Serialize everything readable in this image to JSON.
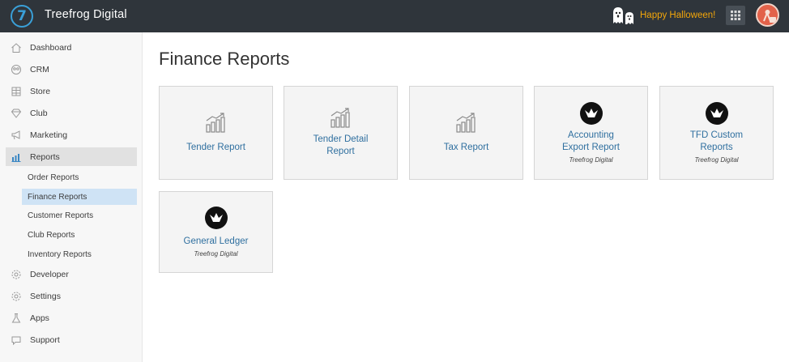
{
  "header": {
    "logo_glyph": "7",
    "brand": "Treefrog Digital",
    "halloween": "Happy Halloween!",
    "accent": "#3aa0d8",
    "halloween_color": "#f3a60a"
  },
  "sidebar": {
    "items": [
      {
        "label": "Dashboard",
        "icon": "home-icon"
      },
      {
        "label": "CRM",
        "icon": "crm-icon"
      },
      {
        "label": "Store",
        "icon": "store-icon"
      },
      {
        "label": "Club",
        "icon": "diamond-icon"
      },
      {
        "label": "Marketing",
        "icon": "megaphone-icon"
      },
      {
        "label": "Reports",
        "icon": "chart-icon",
        "active": true
      },
      {
        "label": "Developer",
        "icon": "gear-icon"
      },
      {
        "label": "Settings",
        "icon": "gear-icon"
      },
      {
        "label": "Apps",
        "icon": "flask-icon"
      },
      {
        "label": "Support",
        "icon": "chat-icon"
      }
    ],
    "reports_sub": [
      {
        "label": "Order Reports"
      },
      {
        "label": "Finance Reports",
        "active": true
      },
      {
        "label": "Customer Reports"
      },
      {
        "label": "Club Reports"
      },
      {
        "label": "Inventory Reports"
      }
    ]
  },
  "main": {
    "title": "Finance Reports",
    "cards": [
      {
        "title": "Tender Report",
        "sub": "",
        "icon": "bar-chart-icon"
      },
      {
        "title": "Tender Detail Report",
        "sub": "",
        "icon": "bar-chart-icon"
      },
      {
        "title": "Tax Report",
        "sub": "",
        "icon": "bar-chart-icon"
      },
      {
        "title": "Accounting Export Report",
        "sub": "Treefrog Digital",
        "icon": "treefrog-badge-icon"
      },
      {
        "title": "TFD Custom Reports",
        "sub": "Treefrog Digital",
        "icon": "treefrog-badge-icon"
      },
      {
        "title": "General Ledger",
        "sub": "Treefrog Digital",
        "icon": "treefrog-badge-icon"
      }
    ]
  }
}
